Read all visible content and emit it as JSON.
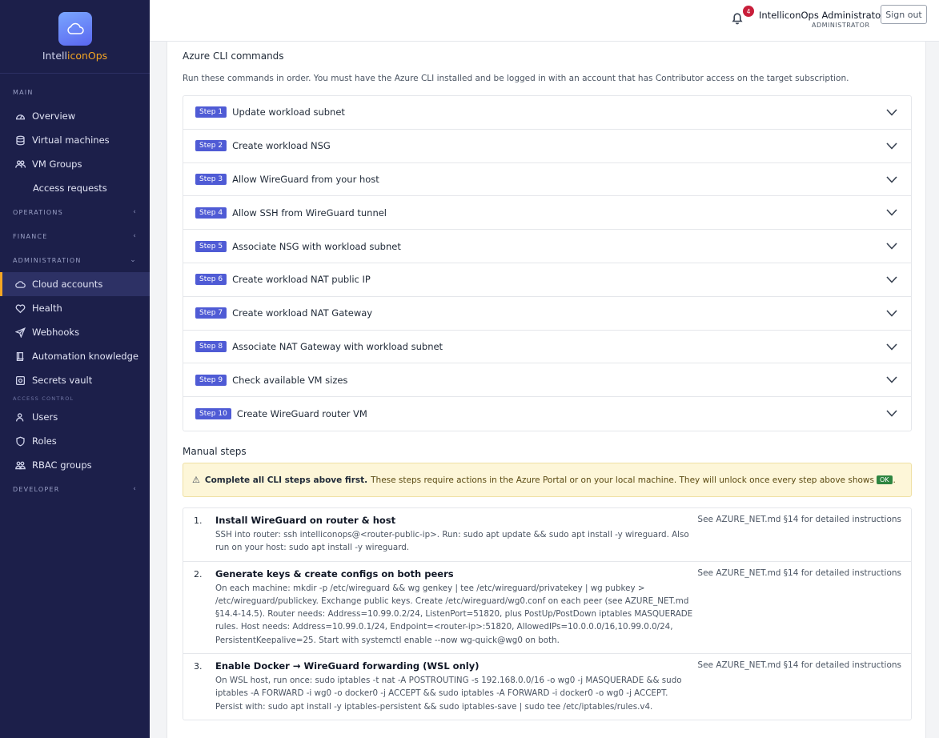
{
  "brand": {
    "prefix": "Intell",
    "highlight": "iconOps"
  },
  "nav": {
    "main_label": "MAIN",
    "main_items": [
      "Overview",
      "Virtual machines",
      "VM Groups",
      "Access requests"
    ],
    "operations_label": "OPERATIONS",
    "finance_label": "FINANCE",
    "administration_label": "ADMINISTRATION",
    "admin_items": [
      "Cloud accounts",
      "Health",
      "Webhooks",
      "Automation knowledge",
      "Secrets vault"
    ],
    "access_control_label": "ACCESS CONTROL",
    "access_items": [
      "Users",
      "Roles",
      "RBAC groups"
    ],
    "developer_label": "DEVELOPER"
  },
  "header": {
    "notification_count": "4",
    "user_name": "IntelliconOps Administrator",
    "user_role": "ADMINISTRATOR",
    "signout_label": "Sign out"
  },
  "azure": {
    "title": "Azure CLI commands",
    "description": "Run these commands in order. You must have the Azure CLI installed and be logged in with an account that has Contributor access on the target subscription.",
    "steps": [
      {
        "badge": "Step 1",
        "title": "Update workload subnet"
      },
      {
        "badge": "Step 2",
        "title": "Create workload NSG"
      },
      {
        "badge": "Step 3",
        "title": "Allow WireGuard from your host"
      },
      {
        "badge": "Step 4",
        "title": "Allow SSH from WireGuard tunnel"
      },
      {
        "badge": "Step 5",
        "title": "Associate NSG with workload subnet"
      },
      {
        "badge": "Step 6",
        "title": "Create workload NAT public IP"
      },
      {
        "badge": "Step 7",
        "title": "Create workload NAT Gateway"
      },
      {
        "badge": "Step 8",
        "title": "Associate NAT Gateway with workload subnet"
      },
      {
        "badge": "Step 9",
        "title": "Check available VM sizes"
      },
      {
        "badge": "Step 10",
        "title": "Create WireGuard router VM"
      }
    ]
  },
  "manual": {
    "title": "Manual steps",
    "warning_bold": "Complete all CLI steps above first.",
    "warning_text": "These steps require actions in the Azure Portal or on your local machine. They will unlock once every step above shows",
    "warning_badge": "OK",
    "warning_end": ".",
    "items": [
      {
        "num": "1.",
        "title": "Install WireGuard on router & host",
        "body": "SSH into router: ssh intelliconops@<router-public-ip>. Run: sudo apt update && sudo apt install -y wireguard. Also run on your host: sudo apt install -y wireguard.",
        "ref": "See AZURE_NET.md §14 for detailed instructions"
      },
      {
        "num": "2.",
        "title": "Generate keys & create configs on both peers",
        "body": "On each machine: mkdir -p /etc/wireguard && wg genkey | tee /etc/wireguard/privatekey | wg pubkey > /etc/wireguard/publickey. Exchange public keys. Create /etc/wireguard/wg0.conf on each peer (see AZURE_NET.md §14.4-14.5). Router needs: Address=10.99.0.2/24, ListenPort=51820, plus PostUp/PostDown iptables MASQUERADE rules. Host needs: Address=10.99.0.1/24, Endpoint=<router-ip>:51820, AllowedIPs=10.0.0.0/16,10.99.0.0/24, PersistentKeepalive=25. Start with systemctl enable --now wg-quick@wg0 on both.",
        "ref": "See AZURE_NET.md §14 for detailed instructions"
      },
      {
        "num": "3.",
        "title": "Enable Docker → WireGuard forwarding (WSL only)",
        "body": "On WSL host, run once: sudo iptables -t nat -A POSTROUTING -s 192.168.0.0/16 -o wg0 -j MASQUERADE && sudo iptables -A FORWARD -i wg0 -o docker0 -j ACCEPT && sudo iptables -A FORWARD -i docker0 -o wg0 -j ACCEPT. Persist with: sudo apt install -y iptables-persistent && sudo iptables-save | sudo tee /etc/iptables/rules.v4.",
        "ref": "See AZURE_NET.md §14 for detailed instructions"
      }
    ]
  }
}
